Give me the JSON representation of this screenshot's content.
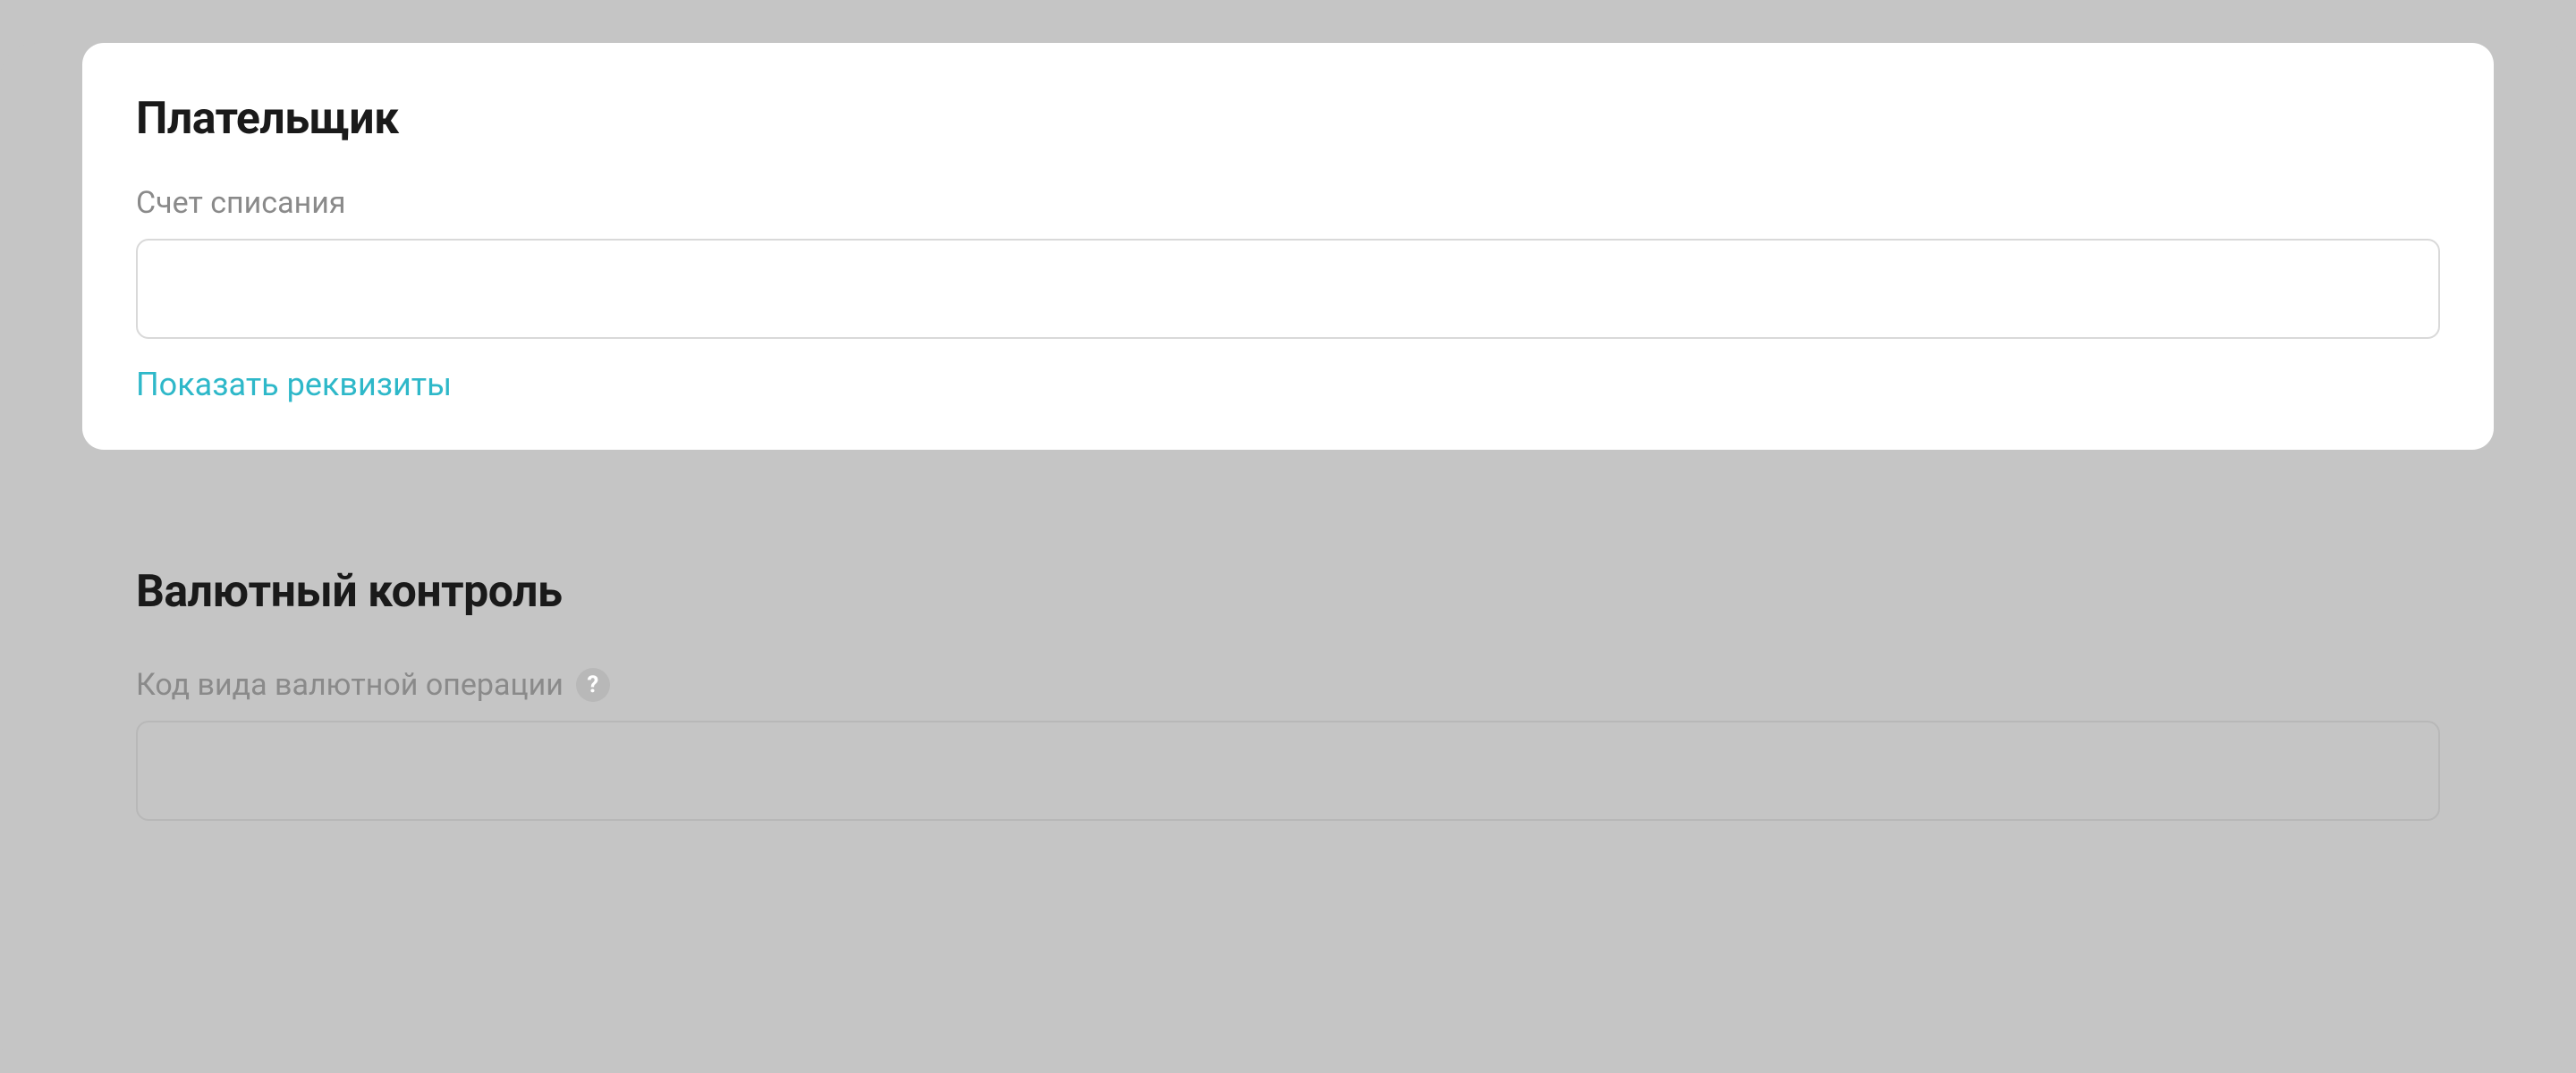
{
  "payer": {
    "title": "Плательщик",
    "account_label": "Счет списания",
    "account_value": "",
    "show_details_link": "Показать реквизиты"
  },
  "currency_control": {
    "title": "Валютный контроль",
    "operation_code_label": "Код вида валютной операции",
    "operation_code_value": "",
    "help_icon_text": "?"
  }
}
